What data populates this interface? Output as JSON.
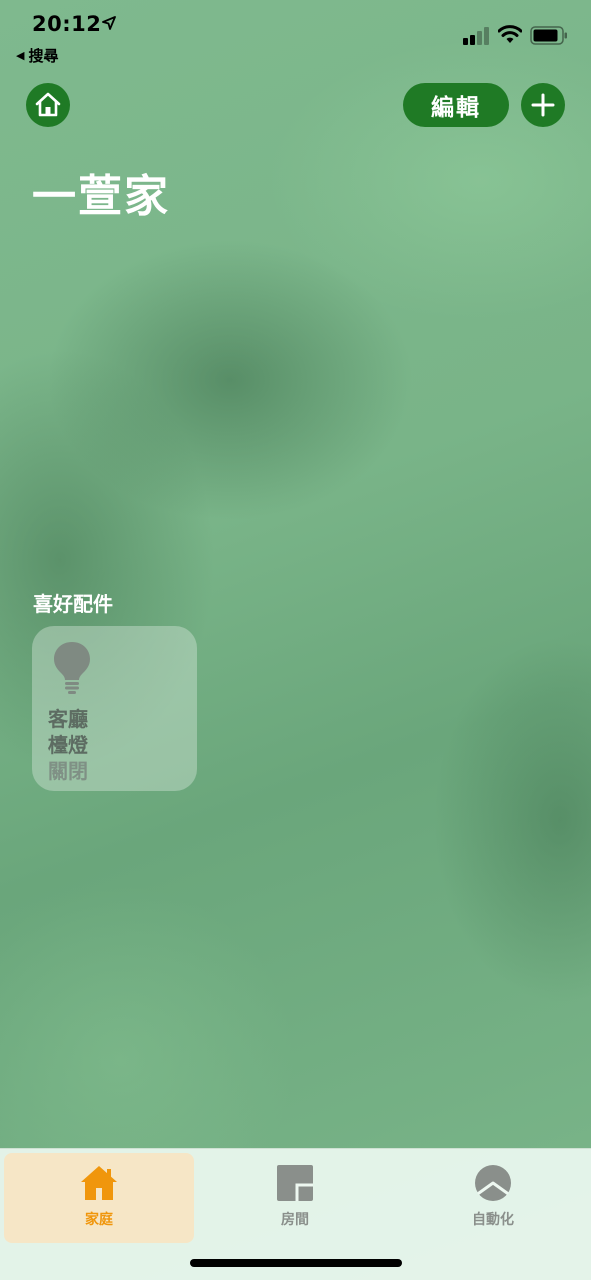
{
  "status_bar": {
    "time": "20:12",
    "back_label": "搜尋",
    "back_icon": "back-triangle-icon",
    "location_icon": "location-arrow-icon",
    "signal_icon": "cellular-signal-icon",
    "wifi_icon": "wifi-icon",
    "battery_icon": "battery-icon"
  },
  "header": {
    "home_icon": "house-icon",
    "edit_label": "編輯",
    "add_icon": "plus-icon"
  },
  "home_title": "一萱家",
  "favorites": {
    "section_title": "喜好配件",
    "accessories": [
      {
        "name_line1": "客廳",
        "name_line2": "檯燈",
        "status": "關閉",
        "icon": "light-bulb-icon"
      }
    ]
  },
  "tab_bar": {
    "tabs": [
      {
        "label": "家庭",
        "icon": "house-tab-icon",
        "selected": true
      },
      {
        "label": "房間",
        "icon": "rooms-tab-icon",
        "selected": false
      },
      {
        "label": "自動化",
        "icon": "clock-tab-icon",
        "selected": false
      }
    ]
  },
  "colors": {
    "accent_green": "#1f7a25",
    "selected_tab": "#f0960c",
    "selected_tab_bg": "#f6e6c6"
  }
}
